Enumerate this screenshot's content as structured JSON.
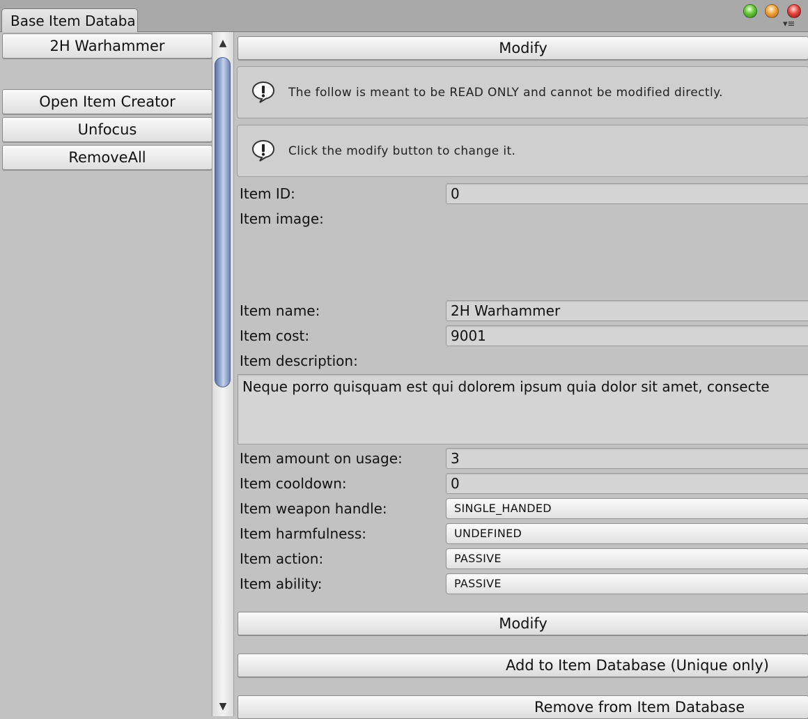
{
  "window": {
    "tab_title": "Base Item Databa"
  },
  "left_panel": {
    "selected_item": "2H Warhammer",
    "buttons": [
      "Open Item Creator",
      "Unfocus",
      "RemoveAll"
    ]
  },
  "main": {
    "modify_top_label": "Modify",
    "help_messages": [
      "The follow is meant to be READ ONLY and cannot be modified directly.",
      "Click the modify button to change it."
    ],
    "fields": {
      "id": {
        "label": "Item ID:",
        "value": "0"
      },
      "image": {
        "label": "Item image:"
      },
      "name": {
        "label": "Item name:",
        "value": "2H Warhammer"
      },
      "cost": {
        "label": "Item cost:",
        "value": "9001"
      },
      "description": {
        "label": "Item description:",
        "value": "Neque porro quisquam est qui dolorem ipsum quia dolor sit amet, consecte"
      },
      "amount": {
        "label": "Item amount on usage:",
        "value": "3"
      },
      "cooldown": {
        "label": "Item cooldown:",
        "value": "0"
      },
      "weapon_handle": {
        "label": "Item weapon handle:",
        "value": "SINGLE_HANDED"
      },
      "harmfulness": {
        "label": "Item harmfulness:",
        "value": "UNDEFINED"
      },
      "action": {
        "label": "Item action:",
        "value": "PASSIVE"
      },
      "ability": {
        "label": "Item ability:",
        "value": "PASSIVE"
      }
    },
    "modify_bottom_label": "Modify",
    "add_label": "Add to Item Database (Unique only)",
    "remove_label": "Remove from Item Database"
  },
  "icons": {
    "info": "info-icon",
    "window_controls": [
      "maximize-icon",
      "minimize-icon",
      "close-icon"
    ],
    "menu": "menu-icon"
  },
  "colors": {
    "background": "#c2c2c2",
    "scroll_thumb": "#7f96c4",
    "close": "#e0443a",
    "minimize": "#f0a23a",
    "maximize": "#64c436"
  }
}
